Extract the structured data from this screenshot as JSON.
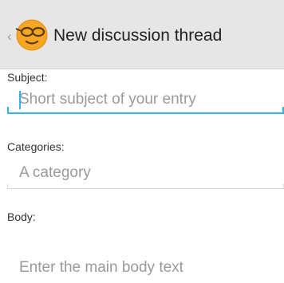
{
  "header": {
    "title": "New discussion thread",
    "up_indicator": "‹",
    "app_icon": "glasses-face-icon",
    "bar_color": "#e6e6e6"
  },
  "form": {
    "subject_label": "Subject:",
    "subject_placeholder": "Short subject of your entry",
    "categories_label": "Categories:",
    "categories_placeholder": "A category",
    "body_label": "Body:",
    "body_placeholder": "Enter the main body text"
  },
  "colors": {
    "focus_accent": "#33b5e5",
    "icon_orange": "#f5a623"
  }
}
